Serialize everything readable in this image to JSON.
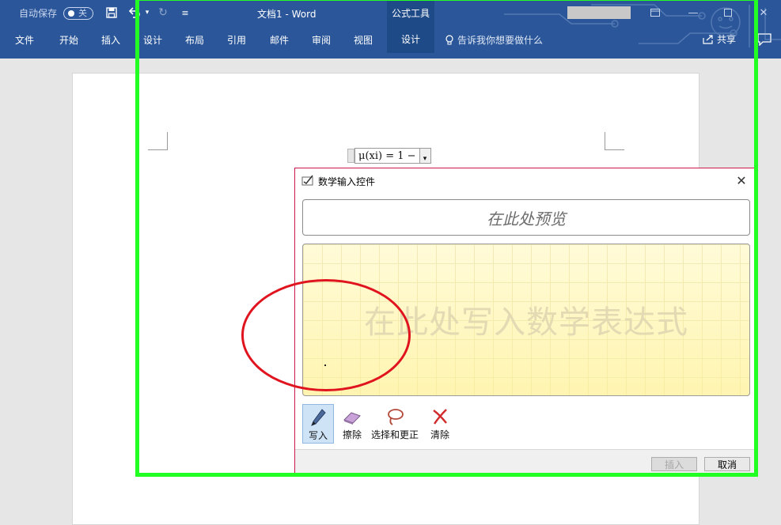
{
  "titlebar": {
    "autosave_label": "自动保存",
    "autosave_state": "关",
    "document_title": "文档1  -  Word",
    "context_tools_label": "公式工具"
  },
  "ribbon": {
    "tabs": [
      "文件",
      "开始",
      "插入",
      "设计",
      "布局",
      "引用",
      "邮件",
      "审阅",
      "视图",
      "设计"
    ],
    "tell_me": "告诉我你想要做什么",
    "share": "共享"
  },
  "document": {
    "equation": "μ(xi) = 1 −"
  },
  "math_input_panel": {
    "title": "数学输入控件",
    "preview_placeholder": "在此处预览",
    "write_placeholder": "在此处写入数学表达式",
    "tools": [
      {
        "label": "写入",
        "icon": "pen-icon",
        "active": true
      },
      {
        "label": "擦除",
        "icon": "eraser-icon",
        "active": false
      },
      {
        "label": "选择和更正",
        "icon": "lasso-icon",
        "active": false
      },
      {
        "label": "清除",
        "icon": "clear-icon",
        "active": false
      }
    ],
    "insert_button": "插入",
    "cancel_button": "取消"
  },
  "colors": {
    "ribbon_blue": "#2b579a",
    "context_tab": "#1e4a87",
    "annotation_green": "#22ff22",
    "annotation_red": "#e0141e"
  }
}
